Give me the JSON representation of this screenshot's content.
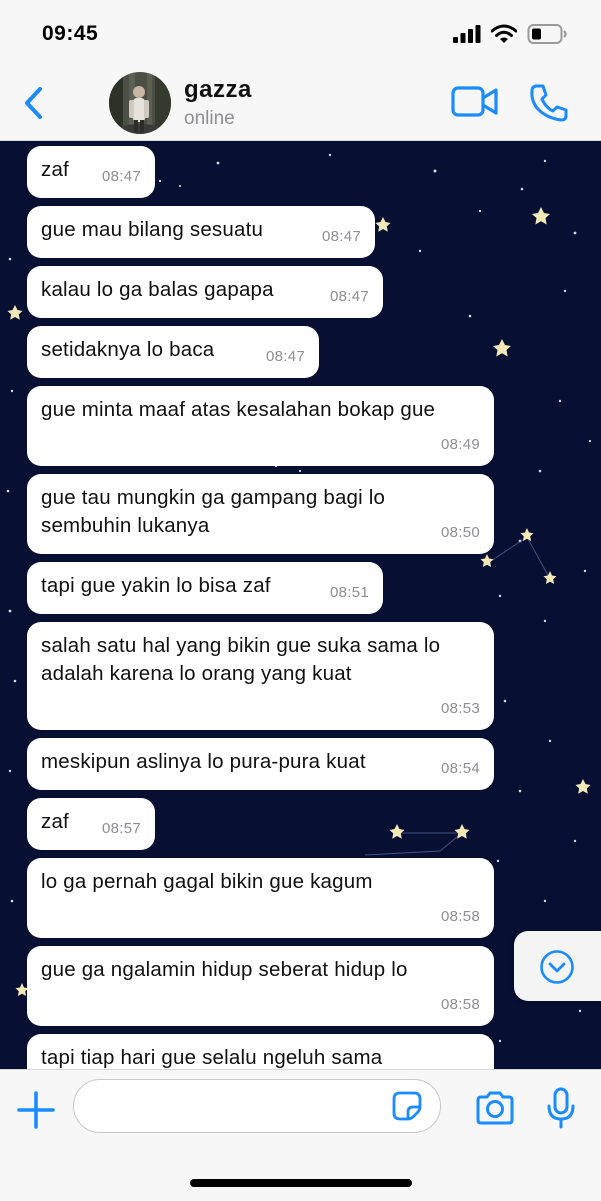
{
  "status_bar": {
    "time": "09:45"
  },
  "header": {
    "name": "gazza",
    "status": "online"
  },
  "messages": [
    {
      "text": "zaf",
      "time": "08:47"
    },
    {
      "text": "gue mau bilang sesuatu",
      "time": "08:47"
    },
    {
      "text": "kalau lo ga balas gapapa",
      "time": "08:47"
    },
    {
      "text": "setidaknya lo baca",
      "time": "08:47"
    },
    {
      "text": "gue minta maaf atas kesalahan bokap gue",
      "time": "08:49"
    },
    {
      "text": "gue tau mungkin ga gampang bagi lo sembuhin lukanya",
      "time": "08:50"
    },
    {
      "text": "tapi gue yakin lo bisa zaf",
      "time": "08:51"
    },
    {
      "text": "salah satu hal yang bikin gue suka sama lo adalah karena lo orang yang kuat",
      "time": "08:53"
    },
    {
      "text": "meskipun aslinya lo pura-pura kuat",
      "time": "08:54"
    },
    {
      "text": "zaf",
      "time": "08:57"
    },
    {
      "text": "lo ga pernah gagal bikin gue kagum",
      "time": "08:58"
    },
    {
      "text": "gue ga ngalamin hidup seberat hidup lo",
      "time": "08:58"
    },
    {
      "text": "tapi tiap hari gue selalu ngeluh sama",
      "time": ""
    }
  ],
  "input": {
    "placeholder": "",
    "value": ""
  },
  "colors": {
    "accent": "#1a8cff",
    "chat_background": "#070f33",
    "bubble": "#ffffff"
  },
  "icons": {
    "back": "chevron-left-icon",
    "video": "video-camera-icon",
    "call": "phone-icon",
    "scroll_down": "chevron-down-circle-icon",
    "add": "plus-icon",
    "sticker": "sticker-icon",
    "camera": "camera-icon",
    "mic": "microphone-icon"
  }
}
